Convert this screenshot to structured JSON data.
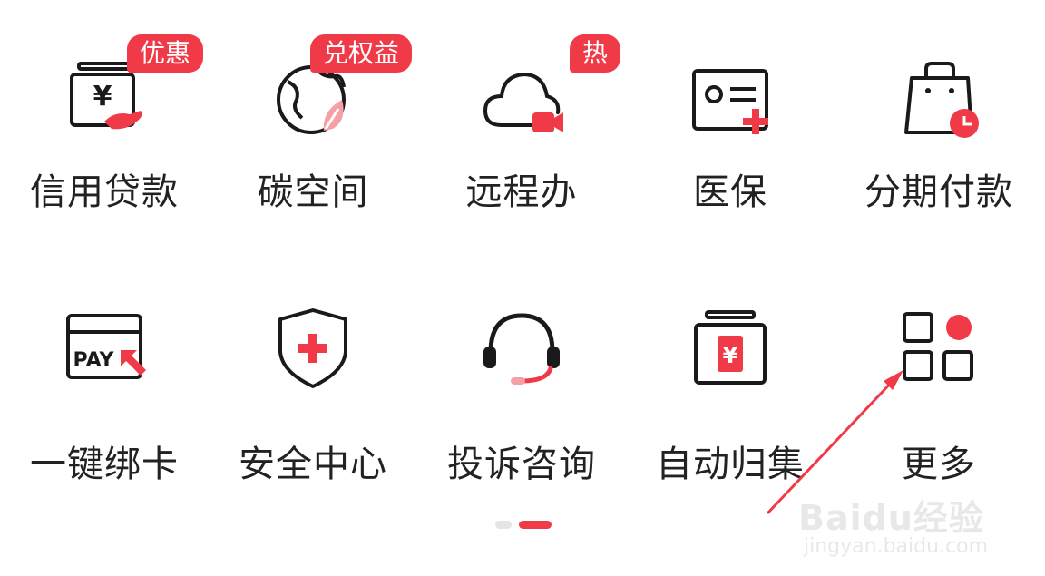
{
  "colors": {
    "accent": "#f03a47",
    "text": "#222222",
    "icon_stroke": "#1a1a1a",
    "watermark": "#e8e8e8"
  },
  "menu": {
    "row1": [
      {
        "label": "信用贷款",
        "icon": "loan-icon",
        "badge": "优惠"
      },
      {
        "label": "碳空间",
        "icon": "globe-leaf-icon",
        "badge": "兑权益"
      },
      {
        "label": "远程办",
        "icon": "cloud-video-icon",
        "badge": "热"
      },
      {
        "label": "医保",
        "icon": "medical-card-icon",
        "badge": ""
      },
      {
        "label": "分期付款",
        "icon": "bag-clock-icon",
        "badge": ""
      }
    ],
    "row2": [
      {
        "label": "一键绑卡",
        "icon": "pay-card-icon",
        "badge": ""
      },
      {
        "label": "安全中心",
        "icon": "shield-plus-icon",
        "badge": ""
      },
      {
        "label": "投诉咨询",
        "icon": "headset-icon",
        "badge": ""
      },
      {
        "label": "自动归集",
        "icon": "yuan-box-icon",
        "badge": ""
      },
      {
        "label": "更多",
        "icon": "grid-more-icon",
        "badge": ""
      }
    ]
  },
  "pager": {
    "pages": 2,
    "current": 2
  },
  "watermark": {
    "brand": "Baidu经验",
    "url": "jingyan.baidu.com"
  }
}
